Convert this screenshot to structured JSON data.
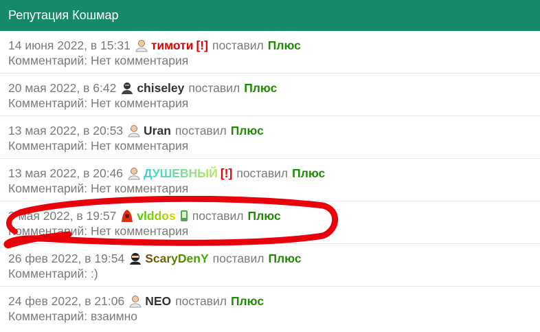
{
  "header": {
    "title": "Репутация Кошмар"
  },
  "comment_label": "Комментарий:",
  "entries": [
    {
      "date": "14 июня 2022, в 15:31",
      "avatar_icon": "user-avatar-icon",
      "user": "тимоти",
      "user_color": "#e60000",
      "flag": "[!]",
      "action": "поставил",
      "vote": "Плюс",
      "comment": "Нет комментария"
    },
    {
      "date": "20 мая 2022, в 6:42",
      "avatar_icon": "dark-avatar-icon",
      "user": "chiseley",
      "user_color": "#333333",
      "flag": "",
      "action": "поставил",
      "vote": "Плюс",
      "comment": "Нет комментария"
    },
    {
      "date": "13 мая 2022, в 20:53",
      "avatar_icon": "user-avatar-icon",
      "user": "Uran",
      "user_color": "#333333",
      "flag": "",
      "action": "поставил",
      "vote": "Плюс",
      "comment": "Нет комментария"
    },
    {
      "date": "13 мая 2022, в 20:46",
      "avatar_icon": "user-avatar-icon",
      "user": "ДУШЕВНЫЙ",
      "user_color": "#4fd6ce",
      "flag": "[!]",
      "action": "поставил",
      "vote": "Плюс",
      "comment": "Нет комментария"
    },
    {
      "date": "3 мая 2022, в 19:57",
      "avatar_icon": "red-hood-avatar-icon",
      "user": "vlddos",
      "user_color": "#3cc800",
      "flag": "",
      "phone_icon": "phone-icon",
      "action": "поставил",
      "vote": "Плюс",
      "comment": "Нет комментария"
    },
    {
      "date": "26 фев 2022, в 19:54",
      "avatar_icon": "ninja-avatar-icon",
      "user": "ScaryDenY",
      "user_color": "#7a4a00",
      "flag": "",
      "action": "поставил",
      "vote": "Плюс",
      "comment": ":)"
    },
    {
      "date": "24 фев 2022, в 21:06",
      "avatar_icon": "user-avatar-icon",
      "user": "NEO",
      "user_color": "#333333",
      "flag": "",
      "action": "поставил",
      "vote": "Плюс",
      "comment": "взаимно"
    }
  ],
  "colors": {
    "header_bg": "#148a6b",
    "vote": "#1d8c00",
    "flag": "#e60000",
    "annotation": "#e8000a"
  }
}
